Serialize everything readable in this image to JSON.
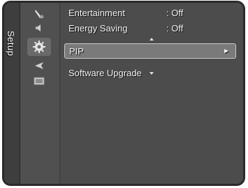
{
  "osd": {
    "category_tab": "Setup",
    "icons": [
      "picture-icon",
      "sound-icon",
      "setup-gear-icon",
      "input-icon",
      "application-icon"
    ],
    "items": [
      {
        "label": "Entertainment",
        "value": ": Off"
      },
      {
        "label": "Energy Saving",
        "value": ": Off"
      },
      {
        "label": "PIP",
        "value": "",
        "arrow": "►"
      },
      {
        "label": "Software Upgrade",
        "value": ""
      }
    ],
    "selected_item": "PIP"
  }
}
